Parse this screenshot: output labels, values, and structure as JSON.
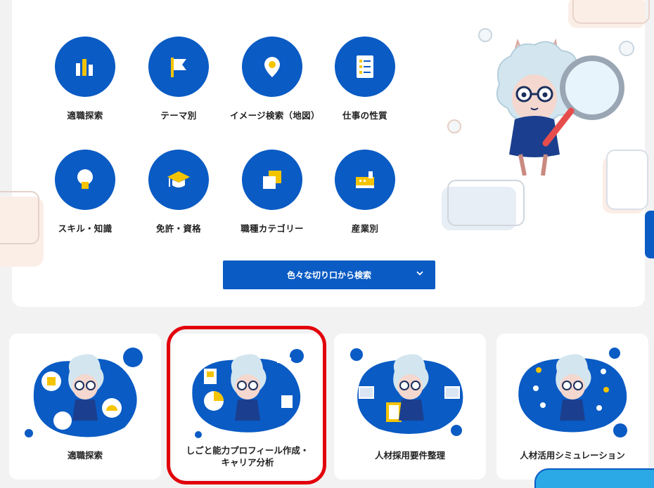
{
  "categories": [
    {
      "label": "適職探索",
      "icon": "bar-chart-icon"
    },
    {
      "label": "テーマ別",
      "icon": "flag-icon"
    },
    {
      "label": "イメージ検索（地図）",
      "icon": "map-pin-icon"
    },
    {
      "label": "仕事の性質",
      "icon": "checklist-icon"
    },
    {
      "label": "スキル・知識",
      "icon": "lightbulb-icon"
    },
    {
      "label": "免許・資格",
      "icon": "graduation-cap-icon"
    },
    {
      "label": "職種カテゴリー",
      "icon": "stacked-squares-icon"
    },
    {
      "label": "産業別",
      "icon": "factory-icon"
    }
  ],
  "search_button": {
    "label": "色々な切り口から検索",
    "icon": "chevron-down-icon"
  },
  "cards": [
    {
      "label": "適職探索"
    },
    {
      "label": "しごと能力プロフィール作成・\nキャリア分析"
    },
    {
      "label": "人材採用要件整理"
    },
    {
      "label": "人材活用シミュレーション"
    }
  ],
  "colors": {
    "brand_blue": "#0a5bc4",
    "accent_yellow": "#f5c400",
    "highlight_red": "#e2000b"
  }
}
